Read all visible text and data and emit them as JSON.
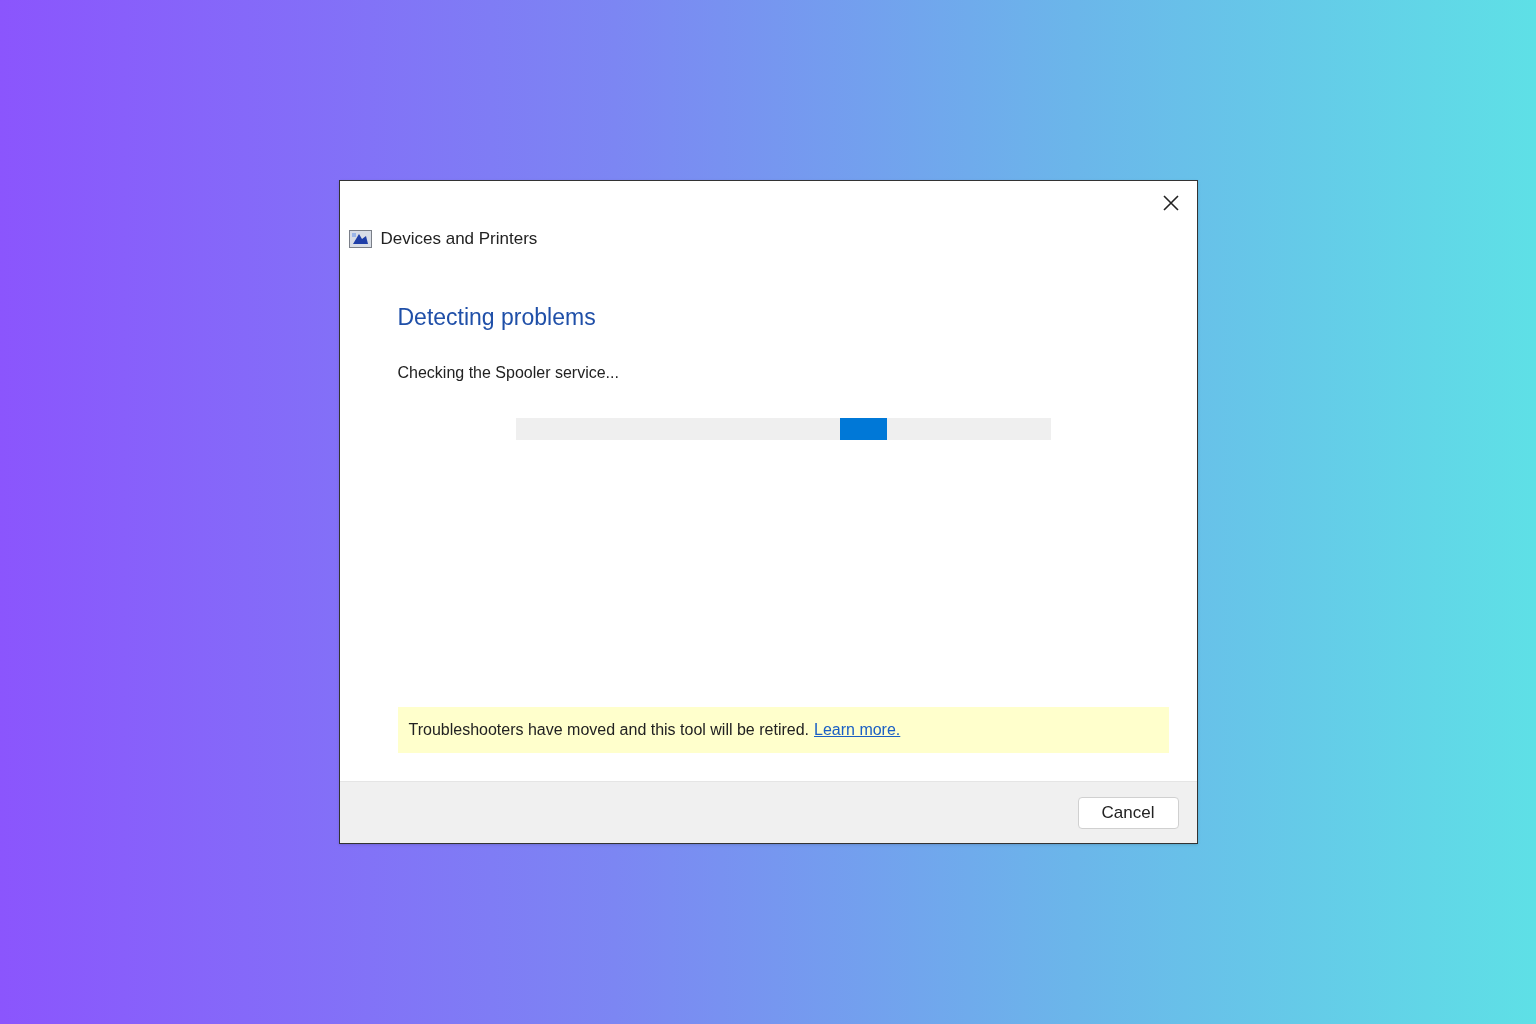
{
  "window": {
    "title": "Devices and Printers"
  },
  "heading": "Detecting problems",
  "status": "Checking the Spooler service...",
  "progress": {
    "kind": "marquee",
    "level": 0.65
  },
  "notice": {
    "text": "Troubleshooters have moved and this tool will be retired.",
    "link": "Learn more."
  },
  "buttons": [
    "Cancel"
  ]
}
